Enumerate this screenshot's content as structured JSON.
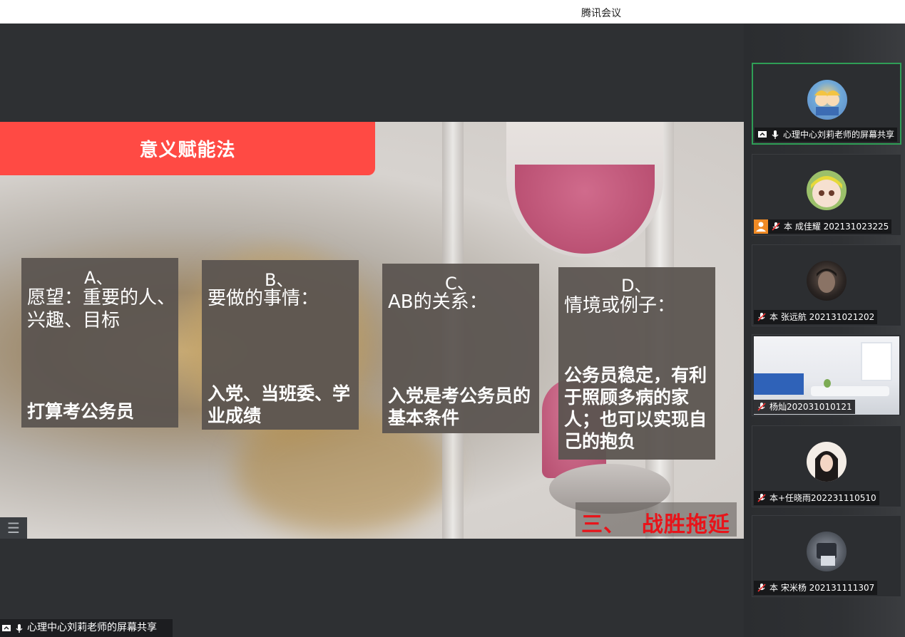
{
  "app": {
    "title": "腾讯会议"
  },
  "slide": {
    "header": "意义赋能法",
    "cards": [
      {
        "letter": "A、",
        "question": "愿望：重要的人、兴趣、目标",
        "answer": "打算考公务员"
      },
      {
        "letter": "B、",
        "question": "要做的事情：",
        "answer": "入党、当班委、学业成绩"
      },
      {
        "letter": "C、",
        "question": "AB的关系：",
        "answer": "入党是考公务员的基本条件"
      },
      {
        "letter": "D、",
        "question": "情境或例子：",
        "answer": "公务员稳定，有利于照顾多病的家人；也可以实现自己的抱负"
      }
    ],
    "footer": "三、  战胜拖延"
  },
  "share_bar": {
    "label": "心理中心刘莉老师的屏幕共享"
  },
  "participants": [
    {
      "name": "心理中心刘莉老师的屏幕共享",
      "icon": "screen-share-icon",
      "mic": "mic-icon",
      "active": true
    },
    {
      "name": "本 成佳耀 202131023225",
      "icon": "person-icon",
      "mic": "mic-muted-icon"
    },
    {
      "name": "本 张远航 202131021202",
      "mic": "mic-muted-icon"
    },
    {
      "name": "杨灿202031010121",
      "mic": "mic-muted-icon"
    },
    {
      "name": "本+任晓雨202231110510",
      "mic": "mic-muted-icon"
    },
    {
      "name": "本 宋米杨 202131111307",
      "mic": "mic-muted-icon"
    }
  ],
  "colors": {
    "header_red": "#ff4a44",
    "footer_red": "#e8141a",
    "active_border": "#2f9e56"
  }
}
